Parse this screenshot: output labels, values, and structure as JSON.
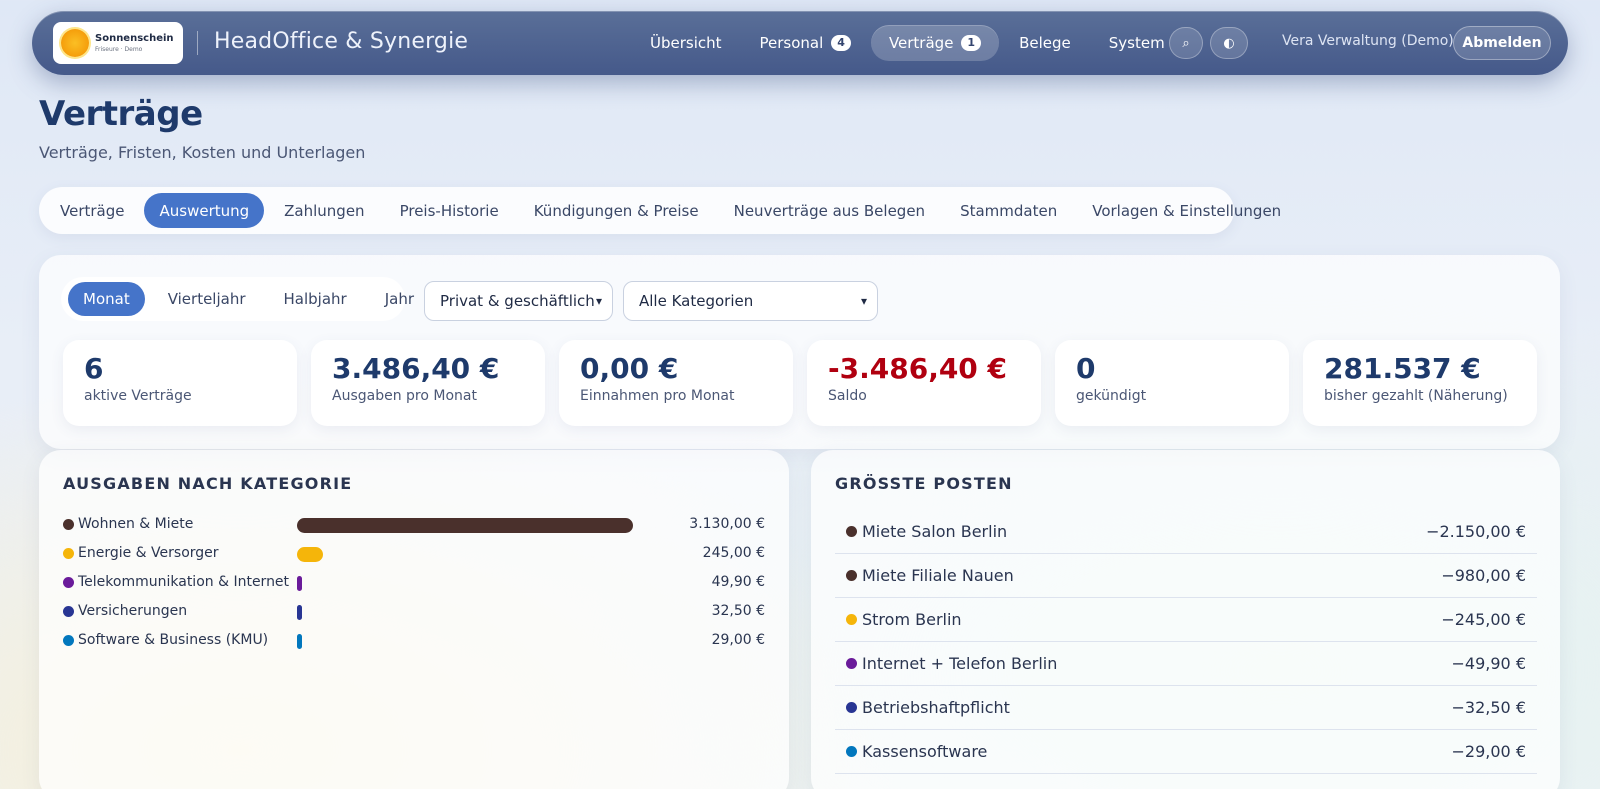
{
  "app": {
    "logo_name": "Sonnenschein",
    "logo_sub": "Friseure · Demo",
    "title": "HeadOffice & Synergie"
  },
  "nav": {
    "items": [
      {
        "label": "Übersicht"
      },
      {
        "label": "Personal",
        "badge": "4"
      },
      {
        "label": "Verträge",
        "badge": "1",
        "active": true
      },
      {
        "label": "Belege"
      },
      {
        "label": "System"
      }
    ],
    "search_glyph": "⌕",
    "theme_glyph": "◐",
    "user": "Vera Verwaltung (Demo)",
    "logout": "Abmelden"
  },
  "page": {
    "title": "Verträge",
    "subtitle": "Verträge, Fristen, Kosten und Unterlagen"
  },
  "subtabs": [
    {
      "label": "Verträge"
    },
    {
      "label": "Auswertung",
      "active": true
    },
    {
      "label": "Zahlungen"
    },
    {
      "label": "Preis-Historie"
    },
    {
      "label": "Kündigungen & Preise"
    },
    {
      "label": "Neuverträge aus Belegen"
    },
    {
      "label": "Stammdaten"
    },
    {
      "label": "Vorlagen & Einstellungen"
    }
  ],
  "filters": {
    "periods": [
      {
        "label": "Monat",
        "active": true
      },
      {
        "label": "Vierteljahr"
      },
      {
        "label": "Halbjahr"
      },
      {
        "label": "Jahr"
      }
    ],
    "scope_select": "Privat & geschäftlich",
    "category_select": "Alle Kategorien"
  },
  "kpis": [
    {
      "value": "6",
      "label": "aktive Verträge"
    },
    {
      "value": "3.486,40 €",
      "label": "Ausgaben pro Monat"
    },
    {
      "value": "0,00 €",
      "label": "Einnahmen pro Monat"
    },
    {
      "value": "-3.486,40 €",
      "label": "Saldo",
      "negative": true
    },
    {
      "value": "0",
      "label": "gekündigt"
    },
    {
      "value": "281.537 €",
      "label": "bisher gezahlt (Näherung)"
    }
  ],
  "categories": {
    "title": "AUSGABEN NACH KATEGORIE",
    "max": 3130,
    "items": [
      {
        "label": "Wohnen & Miete",
        "value": "3.130,00 €",
        "amount": 3130,
        "color": "#4a302c"
      },
      {
        "label": "Energie & Versorger",
        "value": "245,00 €",
        "amount": 245,
        "color": "#f5b50a"
      },
      {
        "label": "Telekommunikation & Internet",
        "value": "49,90 €",
        "amount": 49.9,
        "color": "#6a1b9a"
      },
      {
        "label": "Versicherungen",
        "value": "32,50 €",
        "amount": 32.5,
        "color": "#283593"
      },
      {
        "label": "Software & Business (KMU)",
        "value": "29,00 €",
        "amount": 29,
        "color": "#0277bd"
      }
    ]
  },
  "posts": {
    "title": "GRÖSSTE POSTEN",
    "items": [
      {
        "label": "Miete Salon Berlin",
        "value": "−2.150,00 €",
        "color": "#4a302c"
      },
      {
        "label": "Miete Filiale Nauen",
        "value": "−980,00 €",
        "color": "#4a302c"
      },
      {
        "label": "Strom Berlin",
        "value": "−245,00 €",
        "color": "#f5b50a"
      },
      {
        "label": "Internet + Telefon Berlin",
        "value": "−49,90 €",
        "color": "#6a1b9a"
      },
      {
        "label": "Betriebshaftpflicht",
        "value": "−32,50 €",
        "color": "#283593"
      },
      {
        "label": "Kassensoftware",
        "value": "−29,00 €",
        "color": "#0277bd"
      }
    ]
  }
}
